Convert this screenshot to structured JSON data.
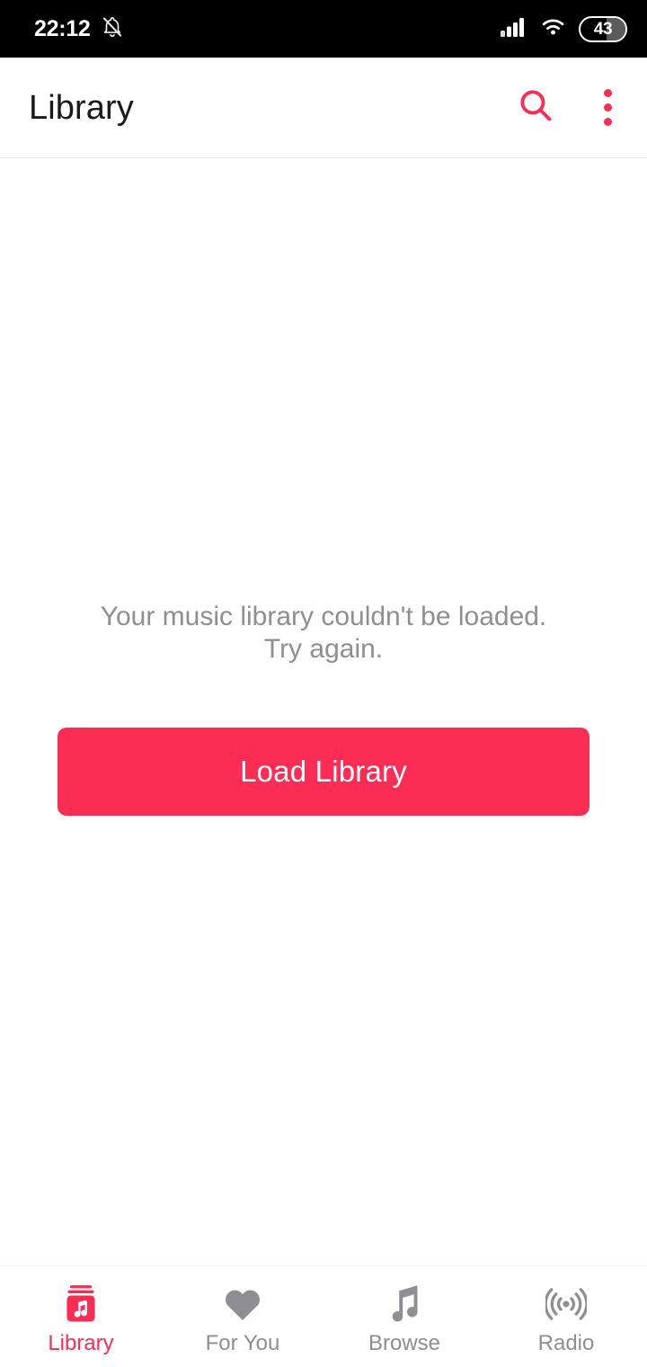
{
  "status_bar": {
    "time": "22:12",
    "notifications_icon": "bell-off-icon",
    "signal_icon": "cellular-signal-icon",
    "wifi_icon": "wifi-icon",
    "battery_level": "43",
    "battery_fill_percent": 43
  },
  "app_bar": {
    "title": "Library",
    "search_icon": "search-icon",
    "overflow_icon": "more-vertical-icon"
  },
  "main": {
    "empty_message": "Your music library couldn't be loaded.\nTry again.",
    "load_button_label": "Load Library"
  },
  "bottom_nav": {
    "items": [
      {
        "label": "Library",
        "icon": "library-icon",
        "active": true
      },
      {
        "label": "For You",
        "icon": "heart-icon",
        "active": false
      },
      {
        "label": "Browse",
        "icon": "music-note-icon",
        "active": false
      },
      {
        "label": "Radio",
        "icon": "radio-broadcast-icon",
        "active": false
      }
    ]
  },
  "colors": {
    "accent": "#fb2d55",
    "muted_text": "#8e8e93",
    "status_bar_bg": "#000000",
    "page_bg": "#ffffff"
  }
}
